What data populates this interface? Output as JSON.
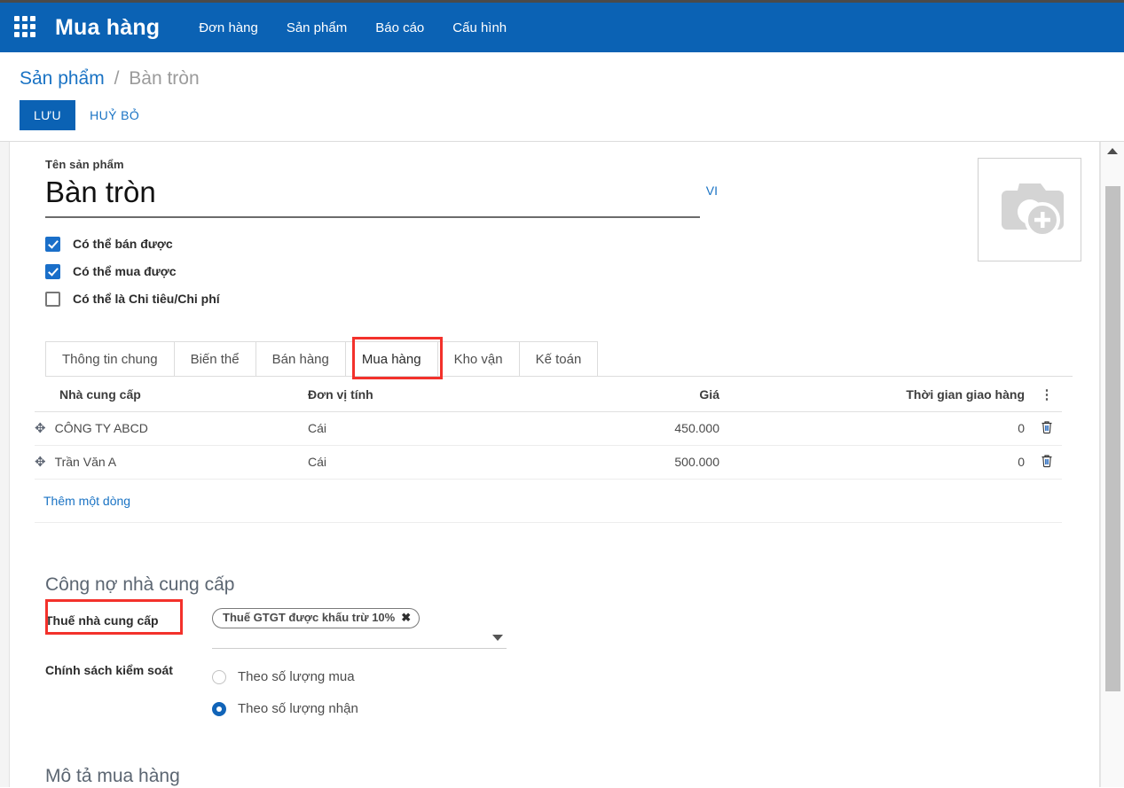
{
  "header": {
    "app_title": "Mua hàng",
    "grid_icon": "apps-grid-icon",
    "nav": [
      {
        "label": "Đơn hàng"
      },
      {
        "label": "Sản phẩm"
      },
      {
        "label": "Báo cáo"
      },
      {
        "label": "Cấu hình"
      }
    ],
    "brand_color": "#0b62b4"
  },
  "breadcrumb": {
    "parent": "Sản phẩm",
    "separator": "/",
    "current": "Bàn tròn"
  },
  "actions": {
    "save_label": "LƯU",
    "cancel_label": "HUỶ BỎ"
  },
  "form": {
    "name_label": "Tên sản phẩm",
    "name_value": "Bàn tròn",
    "lang_tag": "VI",
    "image_placeholder_icon": "camera-add-icon",
    "checkboxes": [
      {
        "label": "Có thể bán được",
        "checked": true
      },
      {
        "label": "Có thể mua được",
        "checked": true
      },
      {
        "label": "Có thể là Chi tiêu/Chi phí",
        "checked": false
      }
    ]
  },
  "tabs": [
    {
      "label": "Thông tin chung",
      "active": false
    },
    {
      "label": "Biến thể",
      "active": false
    },
    {
      "label": "Bán hàng",
      "active": false
    },
    {
      "label": "Mua hàng",
      "active": true
    },
    {
      "label": "Kho vận",
      "active": false
    },
    {
      "label": "Kế toán",
      "active": false
    }
  ],
  "highlight_color": "#f3312b",
  "supplier_table": {
    "columns": [
      "Nhà cung cấp",
      "Đơn vị tính",
      "Giá",
      "Thời gian giao hàng"
    ],
    "menu_icon": "kebab-menu-icon",
    "rows": [
      {
        "drag_icon": "drag-move-icon",
        "supplier": "CÔNG TY ABCD",
        "uom": "Cái",
        "price": "450.000",
        "lead_time": "0",
        "delete_icon": "trash-icon"
      },
      {
        "drag_icon": "drag-move-icon",
        "supplier": "Trần Văn A",
        "uom": "Cái",
        "price": "500.000",
        "lead_time": "0",
        "delete_icon": "trash-icon"
      }
    ],
    "add_row_label": "Thêm một dòng"
  },
  "vendor_bill": {
    "section_title": "Công nợ nhà cung cấp",
    "tax_label": "Thuế nhà cung cấp",
    "tax_chip": "Thuế GTGT được khấu trừ 10%",
    "tax_chip_remove_icon": "chip-remove-icon",
    "dropdown_icon": "chevron-down-icon",
    "control_label": "Chính sách kiểm soát",
    "control_options": [
      {
        "label": "Theo số lượng mua",
        "selected": false
      },
      {
        "label": "Theo số lượng nhận",
        "selected": true
      }
    ]
  },
  "purchase_description": {
    "section_title": "Mô tả mua hàng"
  },
  "scrollbar": {
    "up_arrow_icon": "scroll-up-icon"
  }
}
